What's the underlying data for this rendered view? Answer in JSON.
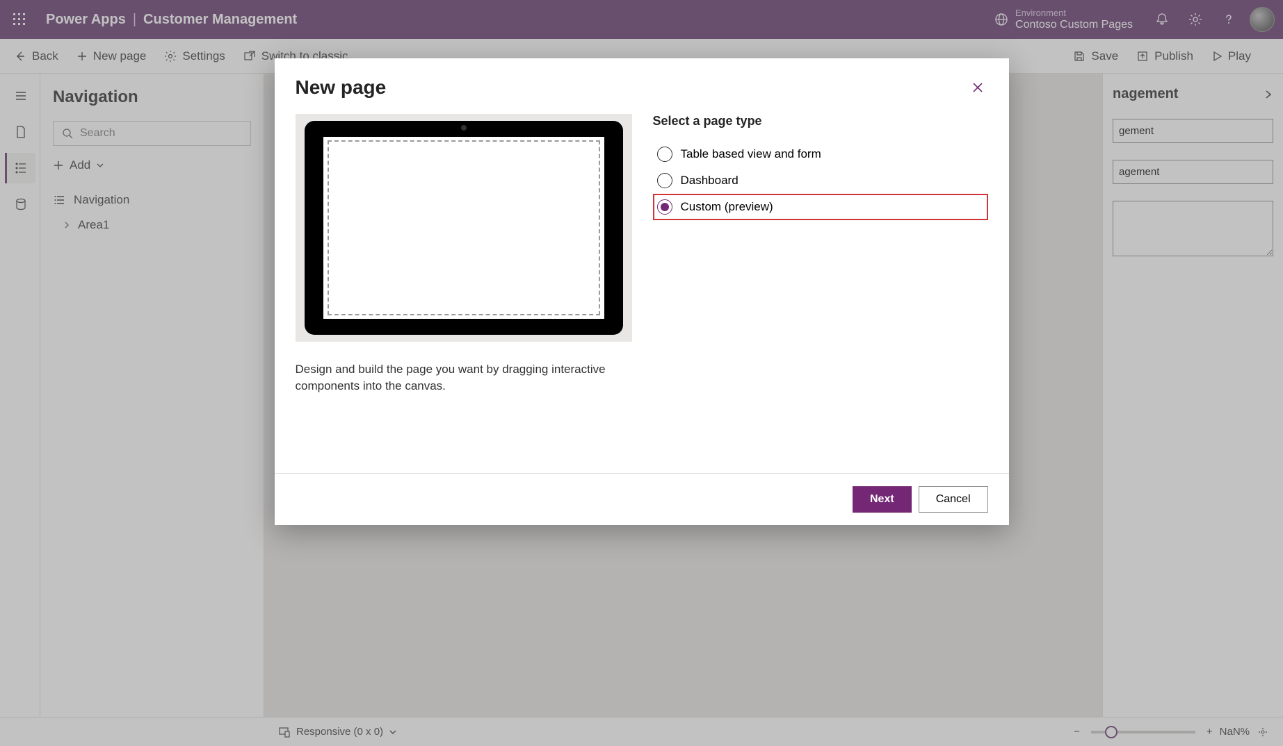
{
  "header": {
    "brand": "Power Apps",
    "app_name": "Customer Management",
    "env_label": "Environment",
    "env_value": "Contoso Custom Pages"
  },
  "cmdbar": {
    "back": "Back",
    "new_page": "New page",
    "settings": "Settings",
    "switch_classic": "Switch to classic",
    "save": "Save",
    "publish": "Publish",
    "play": "Play"
  },
  "nav": {
    "title": "Navigation",
    "search_placeholder": "Search",
    "add": "Add",
    "tree_root": "Navigation",
    "tree_area": "Area1"
  },
  "rightpanel": {
    "title_suffix": "nagement",
    "display_value_suffix": "gement",
    "name_value_suffix": "agement"
  },
  "statusbar": {
    "responsive": "Responsive (0 x 0)",
    "zoom": "NaN%"
  },
  "modal": {
    "title": "New page",
    "description": "Design and build the page you want by dragging interactive components into the canvas.",
    "select_label": "Select a page type",
    "options": {
      "table": "Table based view and form",
      "dashboard": "Dashboard",
      "custom": "Custom (preview)"
    },
    "next": "Next",
    "cancel": "Cancel"
  }
}
